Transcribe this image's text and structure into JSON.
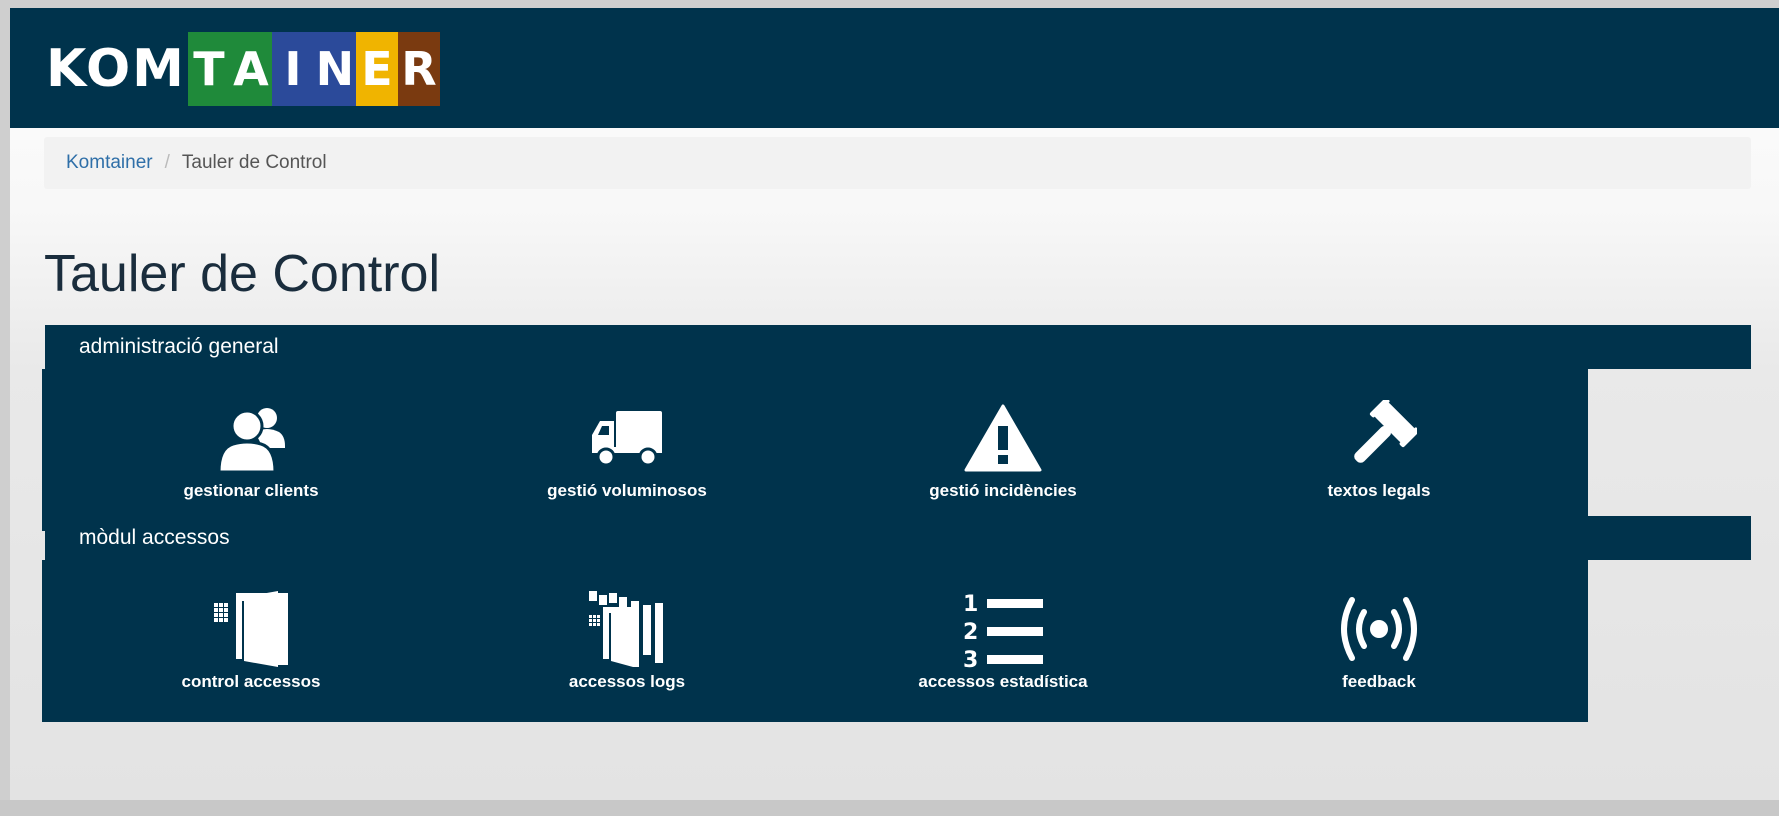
{
  "header": {
    "logo_plain": "KOM",
    "logo_letters": [
      {
        "letter": "T",
        "color": "#1f8a3a"
      },
      {
        "letter": "A",
        "color": "#1f8a3a"
      },
      {
        "letter": "I",
        "color": "#2b4a9a"
      },
      {
        "letter": "N",
        "color": "#2b4a9a"
      },
      {
        "letter": "E",
        "color": "#f0b400"
      },
      {
        "letter": "R",
        "color": "#7a3a10"
      }
    ],
    "bar_color": "#00334c"
  },
  "breadcrumb": {
    "home": "Komtainer",
    "separator": "/",
    "current": "Tauler de Control"
  },
  "page_title": "Tauler de Control",
  "sections": [
    {
      "title": "administració general",
      "tiles": [
        {
          "label": "gestionar clients",
          "icon": "users-icon"
        },
        {
          "label": "gestió voluminosos",
          "icon": "truck-icon"
        },
        {
          "label": "gestió incidències",
          "icon": "warning-icon"
        },
        {
          "label": "textos legals",
          "icon": "gavel-icon"
        }
      ]
    },
    {
      "title": "mòdul accessos",
      "tiles": [
        {
          "label": "control accessos",
          "icon": "door-keypad-icon"
        },
        {
          "label": "accessos logs",
          "icon": "door-logs-icon"
        },
        {
          "label": "accessos estadística",
          "icon": "ordered-list-icon"
        },
        {
          "label": "feedback",
          "icon": "broadcast-icon"
        }
      ]
    }
  ]
}
